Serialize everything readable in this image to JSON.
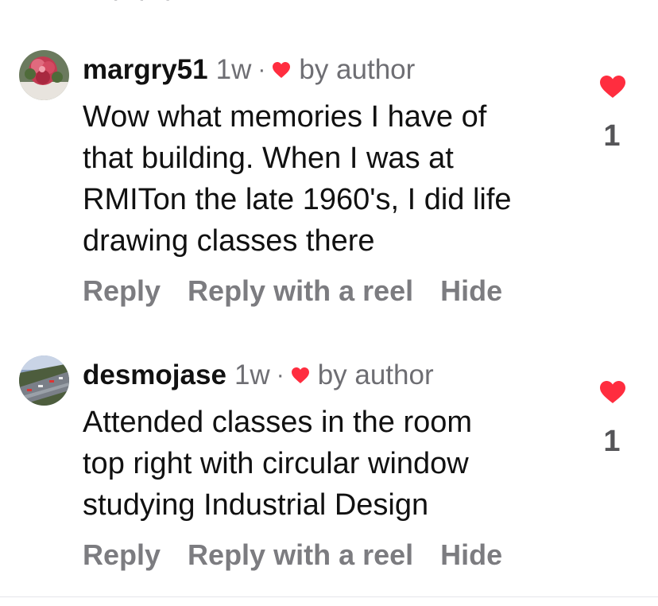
{
  "comments": [
    {
      "username": "margry51",
      "time": "1w",
      "separator": "·",
      "by_author": "by author",
      "lines": [
        "Wow what memories I have of",
        "that building. When I was at",
        "RMITon the late 1960's, I did life",
        "drawing classes there"
      ],
      "actions": {
        "reply": "Reply",
        "reply_reel": "Reply with a reel",
        "hide": "Hide"
      },
      "like_count": "1",
      "avatar_icon": "flower-photo-avatar"
    },
    {
      "username": "desmojase",
      "time": "1w",
      "separator": "·",
      "by_author": "by author",
      "lines": [
        "Attended classes in the room",
        "top right with circular window",
        "studying Industrial Design"
      ],
      "actions": {
        "reply": "Reply",
        "reply_reel": "Reply with a reel",
        "hide": "Hide"
      },
      "like_count": "1",
      "avatar_icon": "highway-photo-avatar"
    }
  ],
  "colors": {
    "heart": "#ff2d3f",
    "secondary_text": "#6e6e73",
    "action_text": "#7c7c80"
  }
}
